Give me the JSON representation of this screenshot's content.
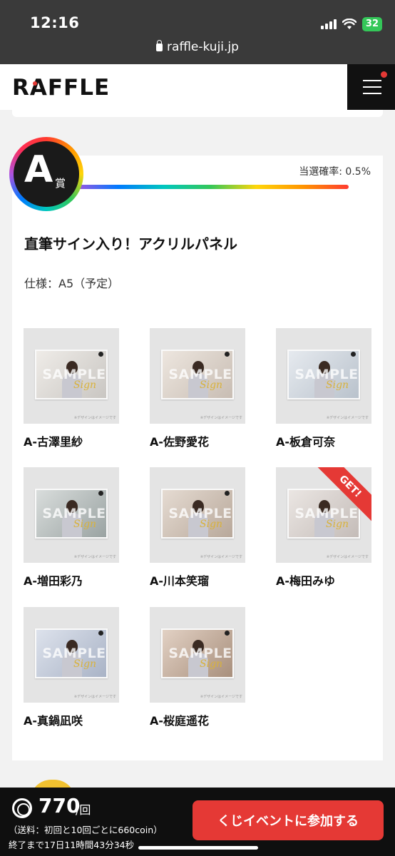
{
  "status_bar": {
    "time": "12:16",
    "battery": "32",
    "url": "raffle-kuji.jp"
  },
  "header": {
    "logo": "RAFFLE"
  },
  "prize": {
    "badge_letter": "A",
    "badge_sub": "賞",
    "win_rate": "当選確率: 0.5%",
    "title": "直筆サイン入り！アクリルパネル",
    "spec": "仕様：A5（予定）",
    "sample_text": "SAMPLE",
    "sign_text": "Sign",
    "note_text": "※デザインはイメージです",
    "got_label": "GET!",
    "items": [
      {
        "label": "A-古澤里紗"
      },
      {
        "label": "A-佐野愛花"
      },
      {
        "label": "A-板倉可奈"
      },
      {
        "label": "A-増田彩乃"
      },
      {
        "label": "A-川本笑瑠"
      },
      {
        "label": "A-梅田みゆ"
      },
      {
        "label": "A-真鍋凪咲"
      },
      {
        "label": "A-桜庭遥花"
      }
    ]
  },
  "bottom": {
    "price": "770",
    "unit": "/回",
    "shipping": "（送料：初回と10回ごとに660coin）",
    "deadline": "終了まで17日11時間43分34秒",
    "join_label": "くじイベントに参加する"
  },
  "colors": {
    "accent": "#e53935",
    "dark": "#0f0f0f",
    "bg": "#f2f2f2"
  },
  "icons": [
    "lock-icon",
    "signal-icon",
    "wifi-icon",
    "battery-icon",
    "menu-icon",
    "coin-icon"
  ]
}
